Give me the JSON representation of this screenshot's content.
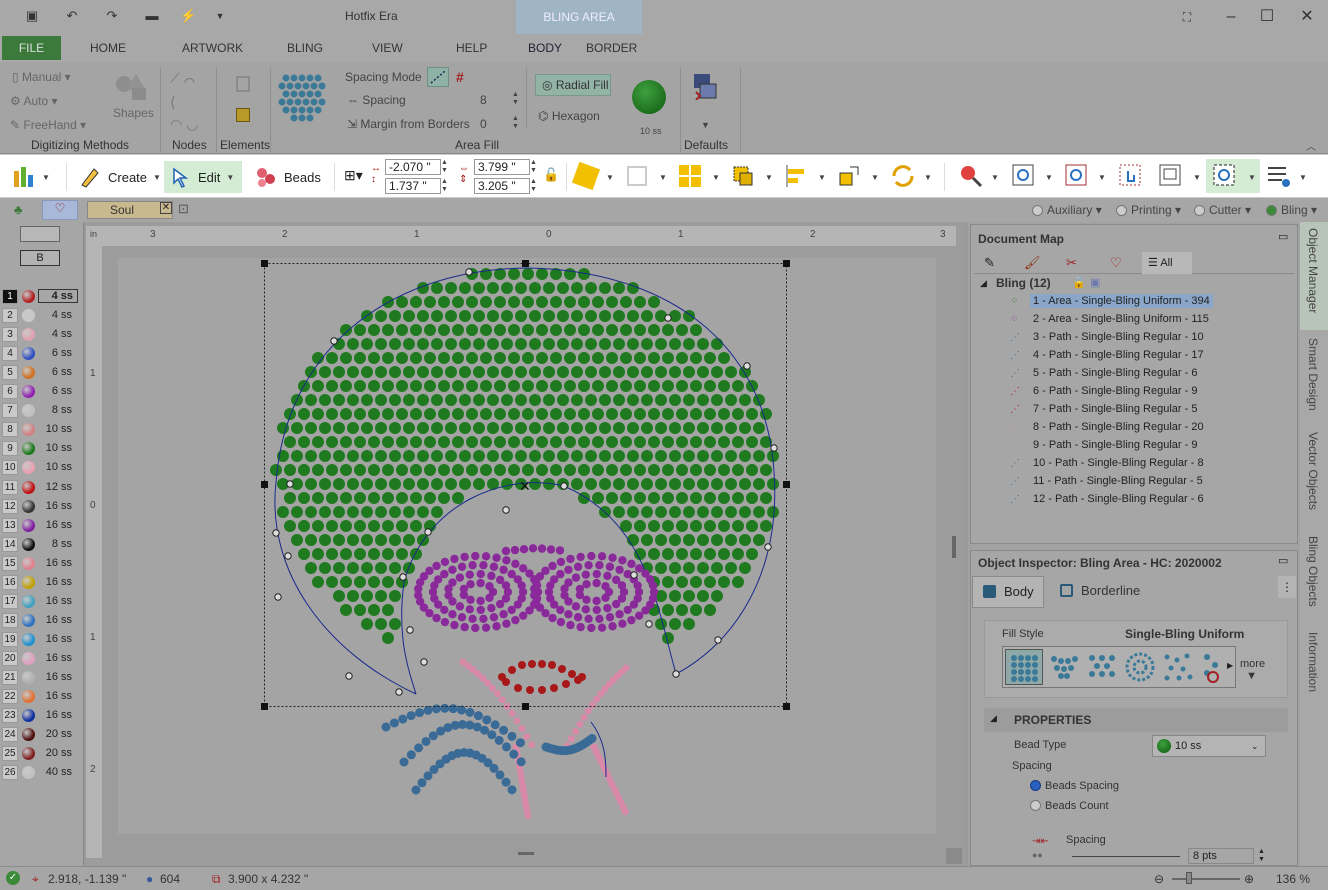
{
  "app": {
    "title": "Hotfix Era",
    "context_tab": "BLING AREA"
  },
  "ribbon_tabs": [
    "FILE",
    "HOME",
    "ARTWORK",
    "BLING",
    "VIEW",
    "HELP",
    "BODY",
    "BORDER"
  ],
  "ribbon": {
    "digitizing": {
      "manual": "Manual",
      "auto": "Auto",
      "freehand": "FreeHand",
      "shapes": "Shapes",
      "group": "Digitizing Methods"
    },
    "nodes_group": "Nodes",
    "elements_group": "Elements",
    "area_fill": {
      "spacing_mode": "Spacing Mode",
      "spacing_label": "Spacing",
      "spacing_value": "8",
      "margin_label": "Margin from Borders",
      "margin_value": "0",
      "radial_fill": "Radial Fill",
      "hexagon": "Hexagon",
      "bead_size": "10 ss",
      "group": "Area Fill"
    },
    "defaults_group": "Defaults"
  },
  "toolbar": {
    "create": "Create",
    "edit": "Edit",
    "beads": "Beads",
    "x": "-2.070 \"",
    "y": "1.737 \"",
    "w": "3.799 \"",
    "h": "3.205 \""
  },
  "doc_tab": "Soul",
  "modes": [
    "Auxiliary",
    "Printing",
    "Cutter",
    "Bling"
  ],
  "palette_header": "B",
  "palette": [
    {
      "n": "1",
      "size": "4 ss",
      "color": "#b02020"
    },
    {
      "n": "2",
      "size": "4 ss",
      "color": "#c8c8c8"
    },
    {
      "n": "3",
      "size": "4 ss",
      "color": "#e0a0b0"
    },
    {
      "n": "4",
      "size": "6 ss",
      "color": "#3050c0"
    },
    {
      "n": "5",
      "size": "6 ss",
      "color": "#d07020"
    },
    {
      "n": "6",
      "size": "6 ss",
      "color": "#9020b0"
    },
    {
      "n": "7",
      "size": "8 ss",
      "color": "#c0c0c0"
    },
    {
      "n": "8",
      "size": "10 ss",
      "color": "#d08080"
    },
    {
      "n": "9",
      "size": "10 ss",
      "color": "#1a7a1a"
    },
    {
      "n": "10",
      "size": "10 ss",
      "color": "#e8a0b0"
    },
    {
      "n": "11",
      "size": "12 ss",
      "color": "#c01010"
    },
    {
      "n": "12",
      "size": "16 ss",
      "color": "#333333"
    },
    {
      "n": "13",
      "size": "16 ss",
      "color": "#8020a0"
    },
    {
      "n": "14",
      "size": "8 ss",
      "color": "#111111"
    },
    {
      "n": "15",
      "size": "16 ss",
      "color": "#e08090"
    },
    {
      "n": "16",
      "size": "16 ss",
      "color": "#c0a000"
    },
    {
      "n": "17",
      "size": "16 ss",
      "color": "#40a0c0"
    },
    {
      "n": "18",
      "size": "16 ss",
      "color": "#3070c0"
    },
    {
      "n": "19",
      "size": "16 ss",
      "color": "#2090d0"
    },
    {
      "n": "20",
      "size": "16 ss",
      "color": "#e0a0c0"
    },
    {
      "n": "21",
      "size": "16 ss",
      "color": "#b0b0b0"
    },
    {
      "n": "22",
      "size": "16 ss",
      "color": "#e07030"
    },
    {
      "n": "23",
      "size": "16 ss",
      "color": "#1030a0"
    },
    {
      "n": "24",
      "size": "20 ss",
      "color": "#501010"
    },
    {
      "n": "25",
      "size": "20 ss",
      "color": "#802020"
    },
    {
      "n": "26",
      "size": "40 ss",
      "color": "#c0c0c0"
    }
  ],
  "ruler": {
    "unit": "in",
    "h_labels": [
      "3",
      "2",
      "1",
      "0",
      "1",
      "2",
      "3"
    ],
    "v_labels": [
      "1",
      "0",
      "1",
      "2"
    ]
  },
  "document_map": {
    "title": "Document Map",
    "all_tab": "All",
    "root": "Bling (12)",
    "items": [
      "1 - Area - Single-Bling Uniform - 394",
      "2 - Area - Single-Bling Uniform - 115",
      "3 - Path - Single-Bling Regular - 10",
      "4 - Path - Single-Bling Regular - 17",
      "5 - Path - Single-Bling Regular - 6",
      "6 - Path - Single-Bling Regular - 9",
      "7 - Path - Single-Bling Regular - 5",
      "8 - Path - Single-Bling Regular - 20",
      "9 - Path - Single-Bling Regular - 9",
      "10 - Path - Single-Bling Regular - 8",
      "11 - Path - Single-Bling Regular - 5",
      "12 - Path - Single-Bling Regular - 6"
    ]
  },
  "inspector": {
    "title": "Object Inspector: Bling Area - HC: 2020002",
    "tab_body": "Body",
    "tab_border": "Borderline",
    "fill_style_label": "Fill Style",
    "fill_style_value": "Single-Bling Uniform",
    "more": "more",
    "properties": "PROPERTIES",
    "bead_type_label": "Bead Type",
    "bead_type_value": "10 ss",
    "spacing_label": "Spacing",
    "beads_spacing": "Beads Spacing",
    "beads_count": "Beads Count",
    "spacing_sub": "Spacing",
    "spacing_value": "8 pts"
  },
  "side_tabs": [
    "Object Manager",
    "Smart Design",
    "Vector Objects",
    "Bling Objects",
    "Information"
  ],
  "status": {
    "coords": "2.918, -1.139 \"",
    "count": "604",
    "size": "3.900 x 4.232 \"",
    "zoom": "136 %"
  },
  "colors": {
    "green_bead": "#1f7a1f",
    "purple_bead": "#8a2a9a",
    "red_bead": "#a81818",
    "pink_bead": "#d98aa8",
    "blue_bead": "#3a6a96",
    "file_tab": "#3c7a3c",
    "toolbar_active": "#d4ecd4"
  }
}
